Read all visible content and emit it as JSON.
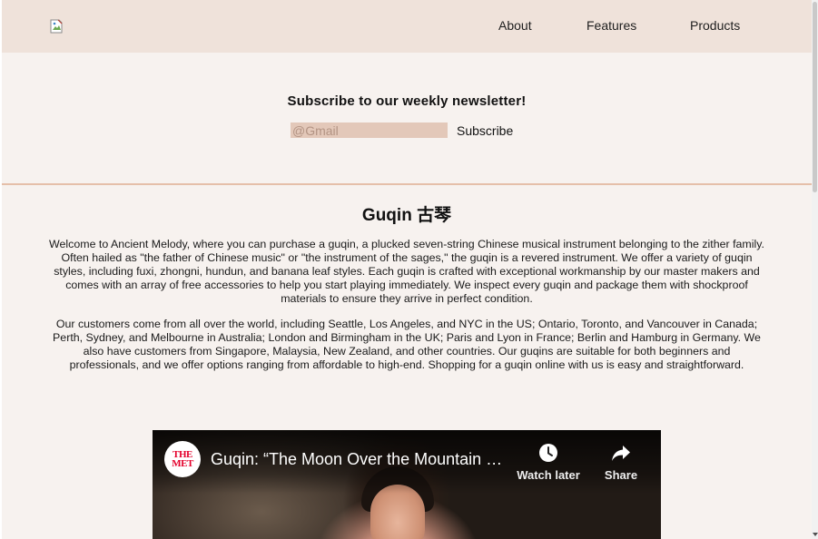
{
  "nav": {
    "logo_icon": "broken-image-icon",
    "links": [
      "About",
      "Features",
      "Products"
    ]
  },
  "newsletter": {
    "title": "Subscribe to our weekly newsletter!",
    "email_placeholder": "@Gmail",
    "email_value": "",
    "button_label": "Subscribe"
  },
  "main": {
    "title": "Guqin 古琴",
    "paragraphs": [
      "Welcome to Ancient Melody, where you can purchase a guqin, a plucked seven-string Chinese musical instrument belonging to the zither family. Often hailed as \"the father of Chinese music\" or \"the instrument of the sages,\" the guqin is a revered instrument. We offer a variety of guqin styles, including fuxi, zhongni, hundun, and banana leaf styles. Each guqin is crafted with exceptional workmanship by our master makers and comes with an array of free accessories to help you start playing immediately. We inspect every guqin and package them with shockproof materials to ensure they arrive in perfect condition.",
      "Our customers come from all over the world, including Seattle, Los Angeles, and NYC in the US; Ontario, Toronto, and Vancouver in Canada; Perth, Sydney, and Melbourne in Australia; London and Birmingham in the UK; Paris and Lyon in France; Berlin and Hamburg in Germany. We also have customers from Singapore, Malaysia, New Zealand, and other countries. Our guqins are suitable for both beginners and professionals, and we offer options ranging from affordable to high-end. Shopping for a guqin online with us is easy and straightforward."
    ]
  },
  "video": {
    "channel_logo_line1": "THE",
    "channel_logo_line2": "MET",
    "title": "Guqin: “The Moon Over the Mountain Gate”",
    "watch_later_label": "Watch later",
    "watch_later_icon": "clock-icon",
    "share_label": "Share",
    "share_icon": "share-arrow-icon"
  },
  "colors": {
    "header_bg": "#efe2da",
    "page_bg": "#f7f2ef",
    "input_bg": "#e3c8b9",
    "divider": "#e5bfa9"
  }
}
